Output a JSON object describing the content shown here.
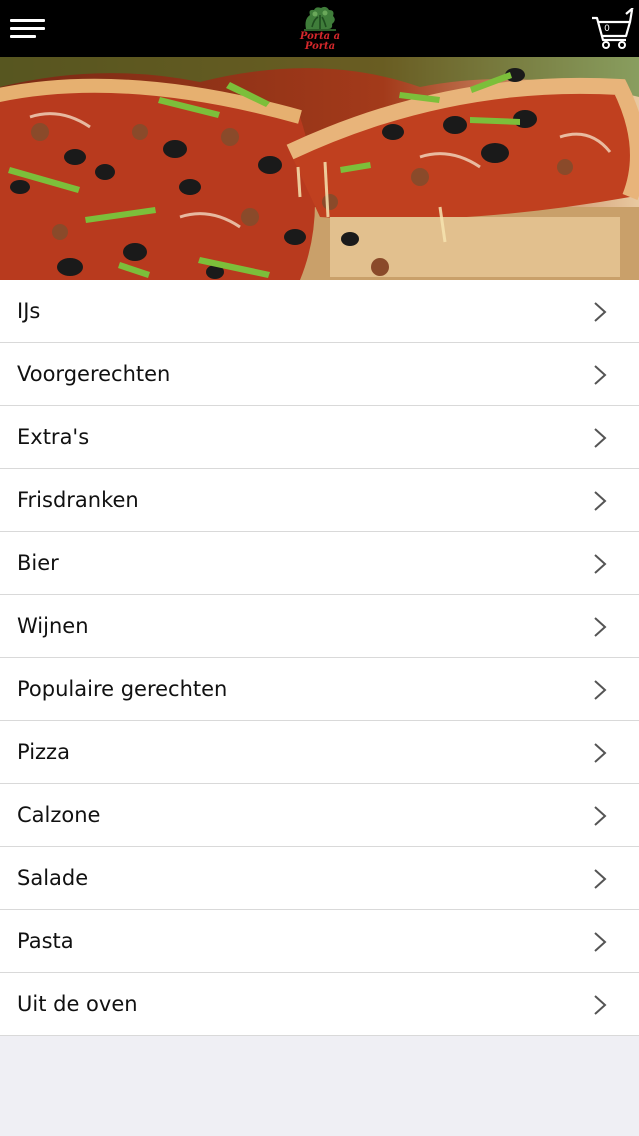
{
  "header": {
    "logo_text": "Porta a Porta",
    "cart_count": "0"
  },
  "categories": [
    "IJs",
    "Voorgerechten",
    "Extra's",
    "Frisdranken",
    "Bier",
    "Wijnen",
    "Populaire gerechten",
    "Pizza",
    "Calzone",
    "Salade",
    "Pasta",
    "Uit de oven"
  ]
}
